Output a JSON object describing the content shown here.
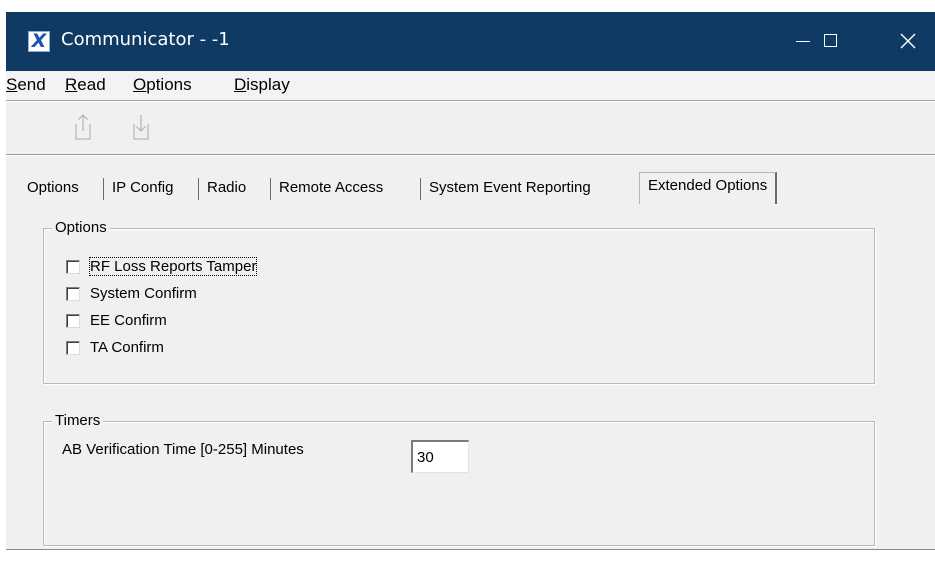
{
  "window": {
    "title": "Communicator - -1",
    "app_icon": "x-logo-icon",
    "controls": [
      "minimize-icon",
      "maximize-icon",
      "close-icon"
    ]
  },
  "menu": {
    "items": [
      {
        "label": "Send",
        "accelerator": "S"
      },
      {
        "label": "Read",
        "accelerator": "R"
      },
      {
        "label": "Options",
        "accelerator": "O"
      },
      {
        "label": "Display",
        "accelerator": "D"
      }
    ]
  },
  "toolbar": {
    "buttons": [
      "send-upload-icon",
      "read-download-icon"
    ]
  },
  "tabs": {
    "items": [
      "Options",
      "IP Config",
      "Radio",
      "Remote Access",
      "System Event Reporting",
      "Extended Options"
    ],
    "active": "Extended Options"
  },
  "options_group": {
    "title": "Options",
    "checkboxes": [
      {
        "label": "RF Loss Reports Tamper",
        "checked": false,
        "focused": true
      },
      {
        "label": "System Confirm",
        "checked": false
      },
      {
        "label": "EE Confirm",
        "checked": false
      },
      {
        "label": "TA Confirm",
        "checked": false
      }
    ]
  },
  "timers_group": {
    "title": "Timers",
    "ab_verification_label": "AB Verification Time [0-255] Minutes",
    "ab_verification_value": "30"
  },
  "colors": {
    "titlebar": "#0e3a63",
    "window_bg": "#f0f0f0"
  }
}
